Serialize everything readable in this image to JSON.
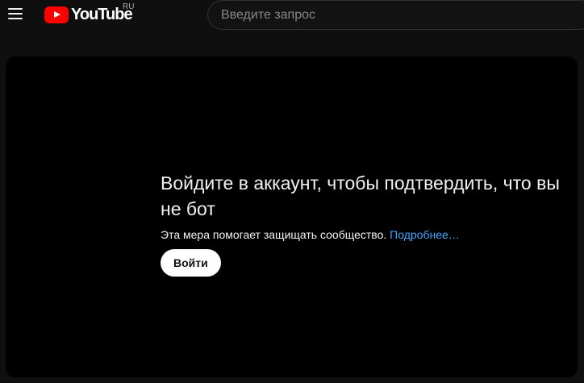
{
  "masthead": {
    "logo_text": "YouTube",
    "country_code": "RU",
    "menu_icon": "hamburger-menu-icon",
    "logo_icon": "youtube-play-icon",
    "brand_color": "#ff0000"
  },
  "search": {
    "placeholder": "Введите запрос",
    "value": ""
  },
  "player_message": {
    "title": "Войдите в аккаунт, чтобы подтвердить, что вы не бот",
    "subtitle": "Эта мера помогает защищать сообщество.",
    "learn_more": "Подробнее…",
    "signin_label": "Войти",
    "link_color": "#3ea6ff"
  }
}
